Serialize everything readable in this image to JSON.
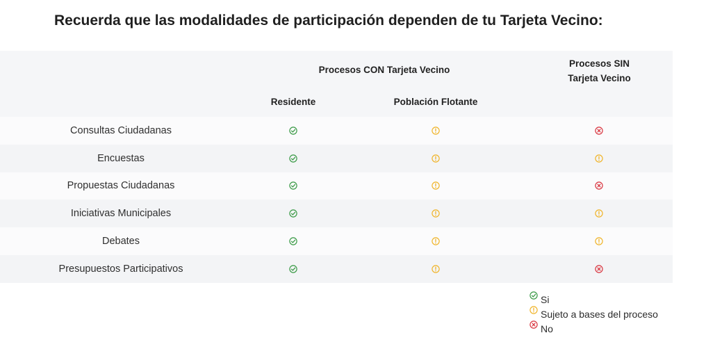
{
  "title": "Recuerda que las modalidades de participación dependen de tu Tarjeta Vecino:",
  "table": {
    "group_con": "Procesos CON Tarjeta Vecino",
    "group_sin_line1": "Procesos SIN",
    "group_sin_line2": "Tarjeta Vecino",
    "col_residente": "Residente",
    "col_poblacion": "Población Flotante",
    "rows": [
      {
        "label": "Consultas Ciudadanas",
        "residente": "yes",
        "poblacion": "conditional",
        "sin": "no"
      },
      {
        "label": "Encuestas",
        "residente": "yes",
        "poblacion": "conditional",
        "sin": "conditional"
      },
      {
        "label": "Propuestas Ciudadanas",
        "residente": "yes",
        "poblacion": "conditional",
        "sin": "no"
      },
      {
        "label": "Iniciativas Municipales",
        "residente": "yes",
        "poblacion": "conditional",
        "sin": "conditional"
      },
      {
        "label": "Debates",
        "residente": "yes",
        "poblacion": "conditional",
        "sin": "conditional"
      },
      {
        "label": "Presupuestos Participativos",
        "residente": "yes",
        "poblacion": "conditional",
        "sin": "no"
      }
    ]
  },
  "legend": {
    "yes": "Si",
    "conditional": "Sujeto a bases del proceso",
    "no": "No"
  },
  "colors": {
    "yes": "#3a9a46",
    "conditional": "#f0b429",
    "no": "#d9353f"
  },
  "icons": {
    "yes": "check-circle-icon",
    "conditional": "exclamation-circle-icon",
    "no": "x-circle-icon"
  }
}
